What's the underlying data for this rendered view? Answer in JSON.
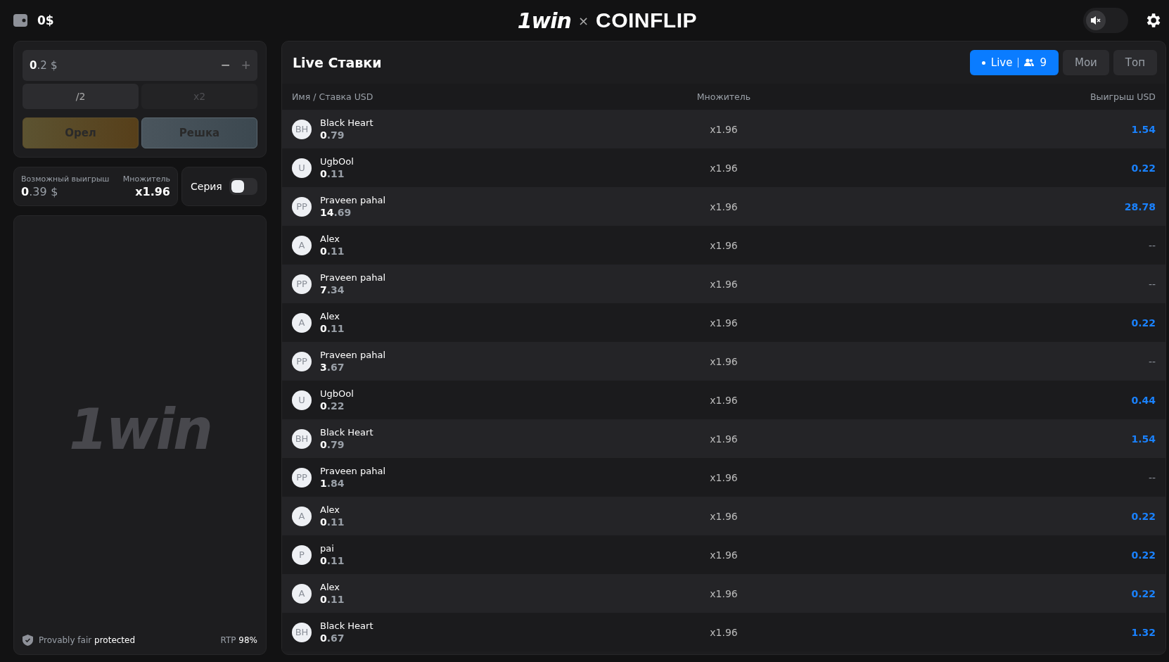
{
  "header": {
    "balance": "0$",
    "logo_brand": "1win",
    "logo_separator": "×",
    "logo_game": "COINFLIP",
    "sound_on": false
  },
  "bet": {
    "amount_whole": "0",
    "amount_fraction": ".2",
    "currency": "$",
    "minus": "−",
    "plus": "+"
  },
  "quick_buttons": [
    {
      "label": "/2",
      "disabled": false
    },
    {
      "label": "x2",
      "disabled": true
    }
  ],
  "sides": [
    {
      "label": "Орел",
      "kind": "heads"
    },
    {
      "label": "Решка",
      "kind": "tails"
    }
  ],
  "summary": {
    "win_label": "Возможный выигрыш",
    "win_whole": "0",
    "win_fraction": ".39",
    "win_currency": "$",
    "multiplier_label": "Множитель",
    "multiplier": "x1.96"
  },
  "series": {
    "label": "Серия",
    "on": false
  },
  "game_area": {
    "watermark": "1win",
    "fair_label": "Provably fair",
    "fair_status": "protected",
    "rtp_label": "RTP",
    "rtp_value": "98%"
  },
  "bets_panel": {
    "title": "Live Ставки",
    "tabs": [
      {
        "label": "Live",
        "count": "9",
        "kind": "live",
        "selected": true
      },
      {
        "label": "Мои",
        "kind": "plain",
        "selected": false
      },
      {
        "label": "Топ",
        "kind": "plain",
        "selected": false
      }
    ],
    "columns": [
      "Имя / Ставка USD",
      "Множитель",
      "Выигрыш USD"
    ],
    "rows": [
      {
        "initials": "BH",
        "name": "Black Heart",
        "stake": "0.79",
        "multiplier": "x1.96",
        "win": "1.54",
        "won": true
      },
      {
        "initials": "U",
        "name": "UgbOol",
        "stake": "0.11",
        "multiplier": "x1.96",
        "win": "0.22",
        "won": true
      },
      {
        "initials": "PP",
        "name": "Praveen pahal",
        "stake": "14.69",
        "multiplier": "x1.96",
        "win": "28.78",
        "won": true
      },
      {
        "initials": "A",
        "name": "Alex",
        "stake": "0.11",
        "multiplier": "x1.96",
        "win": "--",
        "won": false
      },
      {
        "initials": "PP",
        "name": "Praveen pahal",
        "stake": "7.34",
        "multiplier": "x1.96",
        "win": "--",
        "won": false
      },
      {
        "initials": "A",
        "name": "Alex",
        "stake": "0.11",
        "multiplier": "x1.96",
        "win": "0.22",
        "won": true
      },
      {
        "initials": "PP",
        "name": "Praveen pahal",
        "stake": "3.67",
        "multiplier": "x1.96",
        "win": "--",
        "won": false
      },
      {
        "initials": "U",
        "name": "UgbOol",
        "stake": "0.22",
        "multiplier": "x1.96",
        "win": "0.44",
        "won": true
      },
      {
        "initials": "BH",
        "name": "Black Heart",
        "stake": "0.79",
        "multiplier": "x1.96",
        "win": "1.54",
        "won": true
      },
      {
        "initials": "PP",
        "name": "Praveen pahal",
        "stake": "1.84",
        "multiplier": "x1.96",
        "win": "--",
        "won": false
      },
      {
        "initials": "A",
        "name": "Alex",
        "stake": "0.11",
        "multiplier": "x1.96",
        "win": "0.22",
        "won": true
      },
      {
        "initials": "P",
        "name": "pai",
        "stake": "0.11",
        "multiplier": "x1.96",
        "win": "0.22",
        "won": true
      },
      {
        "initials": "A",
        "name": "Alex",
        "stake": "0.11",
        "multiplier": "x1.96",
        "win": "0.22",
        "won": true
      },
      {
        "initials": "BH",
        "name": "Black Heart",
        "stake": "0.67",
        "multiplier": "x1.96",
        "win": "1.32",
        "won": true
      }
    ]
  }
}
